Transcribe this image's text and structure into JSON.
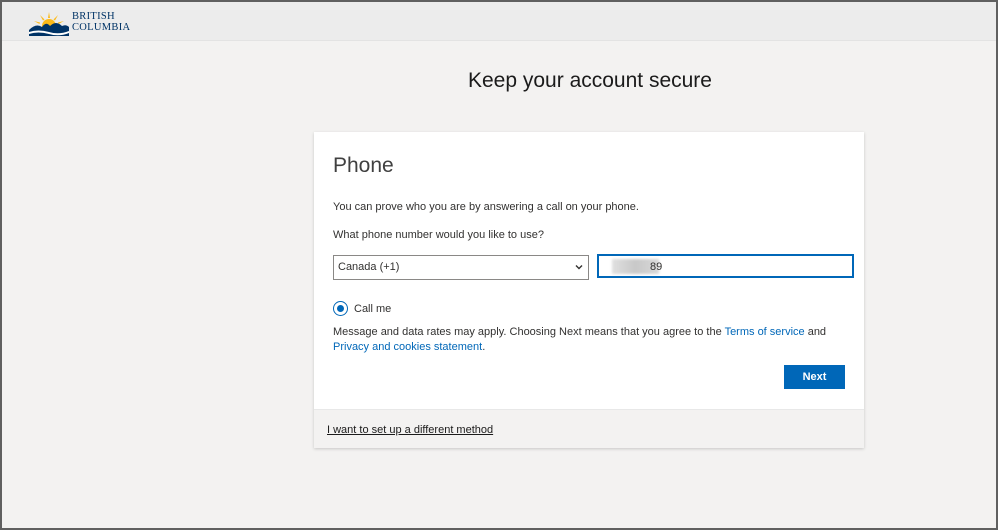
{
  "brand": {
    "logo_line1": "BRITISH",
    "logo_line2": "COLUMBIA",
    "sun_color": "#fcba19",
    "primary_color": "#003366"
  },
  "page": {
    "heading": "Keep your account secure"
  },
  "card": {
    "title": "Phone",
    "intro": "You can prove who you are by answering a call on your phone.",
    "question": "What phone number would you like to use?",
    "country_select": {
      "value": "Canada (+1)",
      "icon": "chevron-down-icon"
    },
    "phone_input": {
      "visible_suffix": "89",
      "redacted": true
    },
    "method_option": {
      "label": "Call me",
      "selected": true
    },
    "disclaimer": {
      "prefix": "Message and data rates may apply. Choosing Next means that you agree to the ",
      "terms_link": "Terms of service",
      "middle": " and ",
      "privacy_link": "Privacy and cookies statement",
      "suffix": "."
    },
    "next_button": "Next",
    "footer_link": "I want to set up a different method"
  },
  "colors": {
    "accent": "#0067b8",
    "page_bg": "#f3f2f1",
    "card_bg": "#ffffff"
  }
}
